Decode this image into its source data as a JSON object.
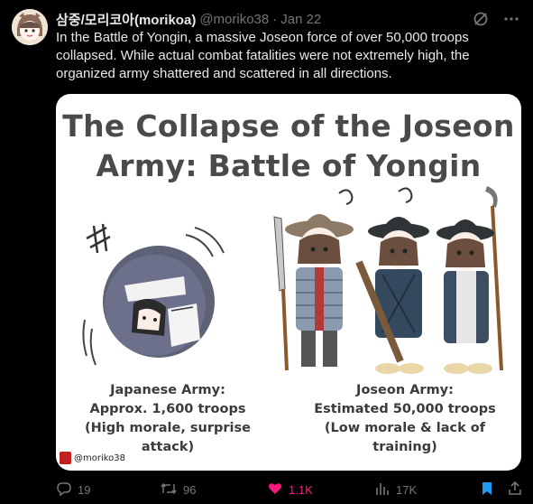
{
  "tweet": {
    "author_name": "삼중/모리코아(morikoa)",
    "handle": "@moriko38",
    "separator": "·",
    "date": "Jan 22",
    "text": "In the Battle of Yongin, a massive Joseon force of over 50,000 troops collapsed. While actual combat fatalities were not extremely high, the organized army shattered and scattered in all directions."
  },
  "image": {
    "title_line1": "The Collapse of the Joseon",
    "title_line2": "Army: Battle of Yongin",
    "japanese": {
      "line1": "Japanese Army:",
      "line2": "Approx. 1,600 troops",
      "line3": "(High morale, surprise attack)"
    },
    "joseon": {
      "line1": "Joseon Army:",
      "line2": "Estimated 50,000 troops",
      "line3": "(Low morale & lack of training)"
    },
    "signature": "@moriko38"
  },
  "actions": {
    "replies": "19",
    "retweets": "96",
    "likes": "1.1K",
    "views": "17K"
  },
  "colors": {
    "background": "#000000",
    "text": "#e7e9ea",
    "muted": "#71767b",
    "like": "#f91880",
    "bookmark": "#1d9bf0"
  },
  "icons": [
    "grok-icon",
    "more-icon",
    "reply-icon",
    "retweet-icon",
    "heart-icon",
    "views-icon",
    "bookmark-icon",
    "share-icon"
  ]
}
